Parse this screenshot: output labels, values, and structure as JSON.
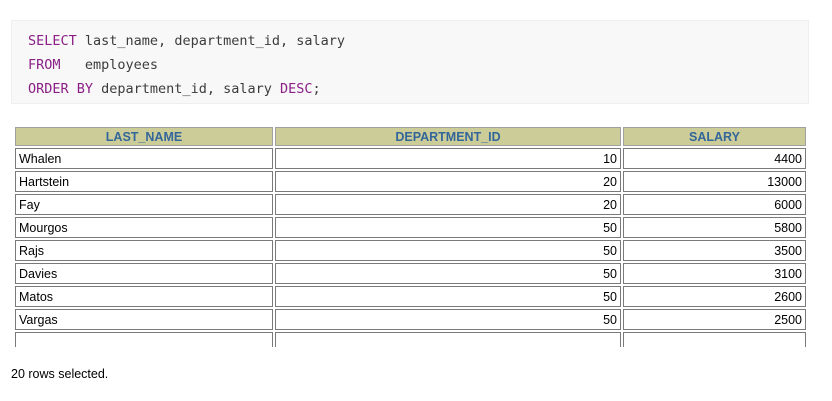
{
  "query": {
    "line1": {
      "keyword": "SELECT",
      "rest": " last_name, department_id, salary"
    },
    "line2": {
      "keyword": "FROM",
      "rest": "   employees"
    },
    "line3": {
      "keyword1": "ORDER BY",
      "middle": " department_id, salary ",
      "keyword2": "DESC",
      "end": ";"
    }
  },
  "table": {
    "headers": [
      "LAST_NAME",
      "DEPARTMENT_ID",
      "SALARY"
    ],
    "rows": [
      [
        "Whalen",
        "10",
        "4400"
      ],
      [
        "Hartstein",
        "20",
        "13000"
      ],
      [
        "Fay",
        "20",
        "6000"
      ],
      [
        "Mourgos",
        "50",
        "5800"
      ],
      [
        "Rajs",
        "50",
        "3500"
      ],
      [
        "Davies",
        "50",
        "3100"
      ],
      [
        "Matos",
        "50",
        "2600"
      ],
      [
        "Vargas",
        "50",
        "2500"
      ],
      [
        "",
        "",
        ""
      ]
    ]
  },
  "footer": {
    "text": "20 rows selected."
  },
  "colors": {
    "header_bg": "#cccc99",
    "header_text": "#336699",
    "keyword": "#8b1f86",
    "code_bg": "#f8f8f8"
  }
}
